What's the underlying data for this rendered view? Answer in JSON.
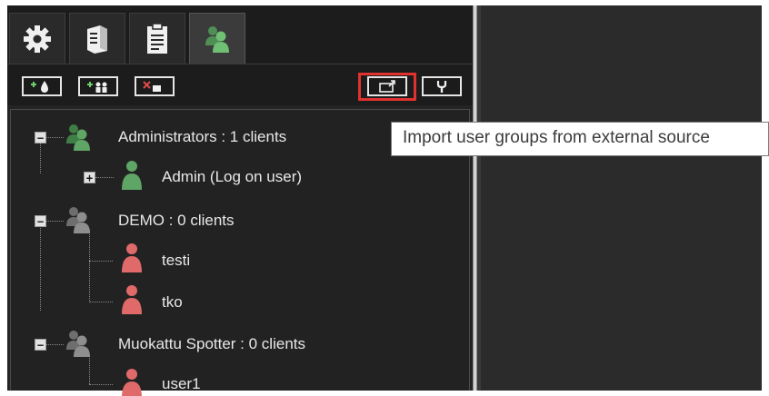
{
  "tabs": [
    {
      "icon": "gear-icon",
      "active": false
    },
    {
      "icon": "server-icon",
      "active": false
    },
    {
      "icon": "clipboard-icon",
      "active": false
    },
    {
      "icon": "user-group-icon",
      "active": true
    }
  ],
  "toolbar": {
    "buttons": [
      {
        "icon": "add-user-icon"
      },
      {
        "icon": "add-group-icon"
      },
      {
        "icon": "remove-icon"
      },
      {
        "icon": "import-icon",
        "highlighted": true
      },
      {
        "icon": "wrench-icon"
      }
    ],
    "highlight_color": "#e0322f"
  },
  "tooltip": {
    "text": "Import user groups from external source"
  },
  "tree": {
    "groups": [
      {
        "label": "Administrators : 1 clients",
        "color": "green",
        "expanded": true,
        "children": [
          {
            "label": "Admin (Log on user)",
            "color": "green",
            "expandable": true
          }
        ]
      },
      {
        "label": "DEMO : 0 clients",
        "color": "gray",
        "expanded": true,
        "children": [
          {
            "label": "testi",
            "color": "red"
          },
          {
            "label": "tko",
            "color": "red"
          }
        ]
      },
      {
        "label": "Muokattu Spotter : 0 clients",
        "color": "gray",
        "expanded": true,
        "children": [
          {
            "label": "user1",
            "color": "red"
          }
        ]
      }
    ]
  },
  "colors": {
    "green": "#5fa565",
    "gray": "#8e8e8e",
    "red": "#e06a6a",
    "background": "#1f1f1f"
  }
}
